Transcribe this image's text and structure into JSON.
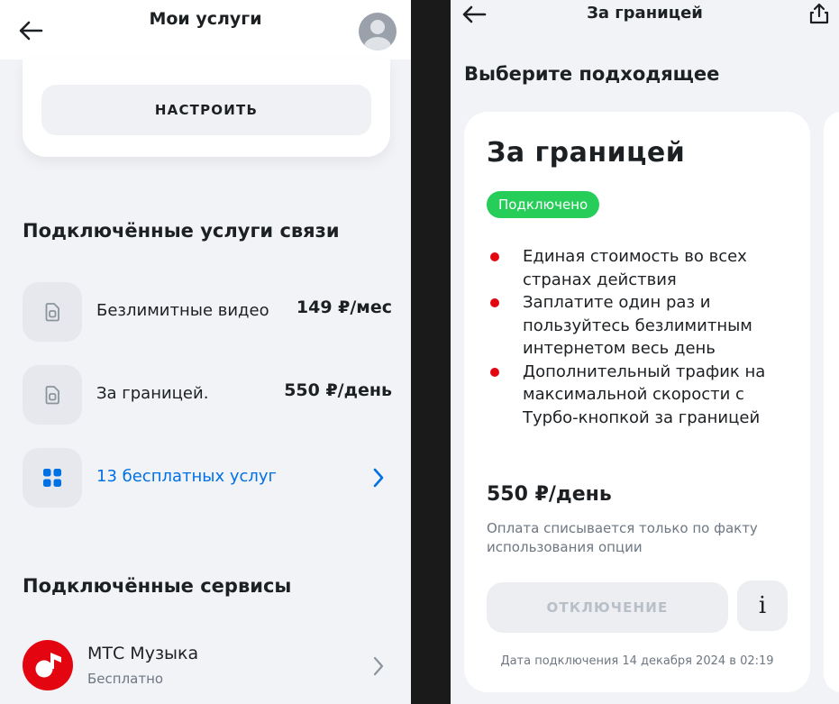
{
  "left_screen": {
    "header": {
      "title": "Мои услуги"
    },
    "top_card": {
      "configure_label": "НАСТРОИТЬ"
    },
    "connected_services": {
      "title": "Подключённые услуги связи",
      "items": [
        {
          "name": "Безлимитные видео",
          "price": "149 ₽/мес",
          "icon": "sim-icon"
        },
        {
          "name": "За границей.",
          "price": "550 ₽/день",
          "icon": "sim-icon"
        },
        {
          "name": "13 бесплатных услуг",
          "icon": "grid-icon",
          "link_color": "#0070e5"
        }
      ]
    },
    "connected_subscriptions": {
      "title": "Подключённые сервисы",
      "items": [
        {
          "name": "МТС Музыка",
          "subtitle": "Бесплатно",
          "icon": "mts-music-icon"
        }
      ]
    }
  },
  "right_screen": {
    "header": {
      "title": "За границей"
    },
    "heading": "Выберите подходящее",
    "offer": {
      "title": "За границей",
      "status": "Подключено",
      "features": [
        "Единая стоимость во всех странах действия",
        "Заплатите один раз и пользуйтесь безлимитным интернетом весь день",
        "Дополнительный трафик на максимальной скорости с Турбо-кнопкой за границей"
      ],
      "price": "550 ₽/день",
      "note": "Оплата списывается только по факту использования опции",
      "disable_label": "ОТКЛЮЧЕНИЕ",
      "info_label": "i",
      "connection_date": "Дата подключения 14 декабря 2024 в 02:19"
    }
  },
  "colors": {
    "accent_red": "#e30611",
    "status_green": "#26cd58",
    "link_blue": "#0070e5",
    "background": "#f2f3f7"
  }
}
